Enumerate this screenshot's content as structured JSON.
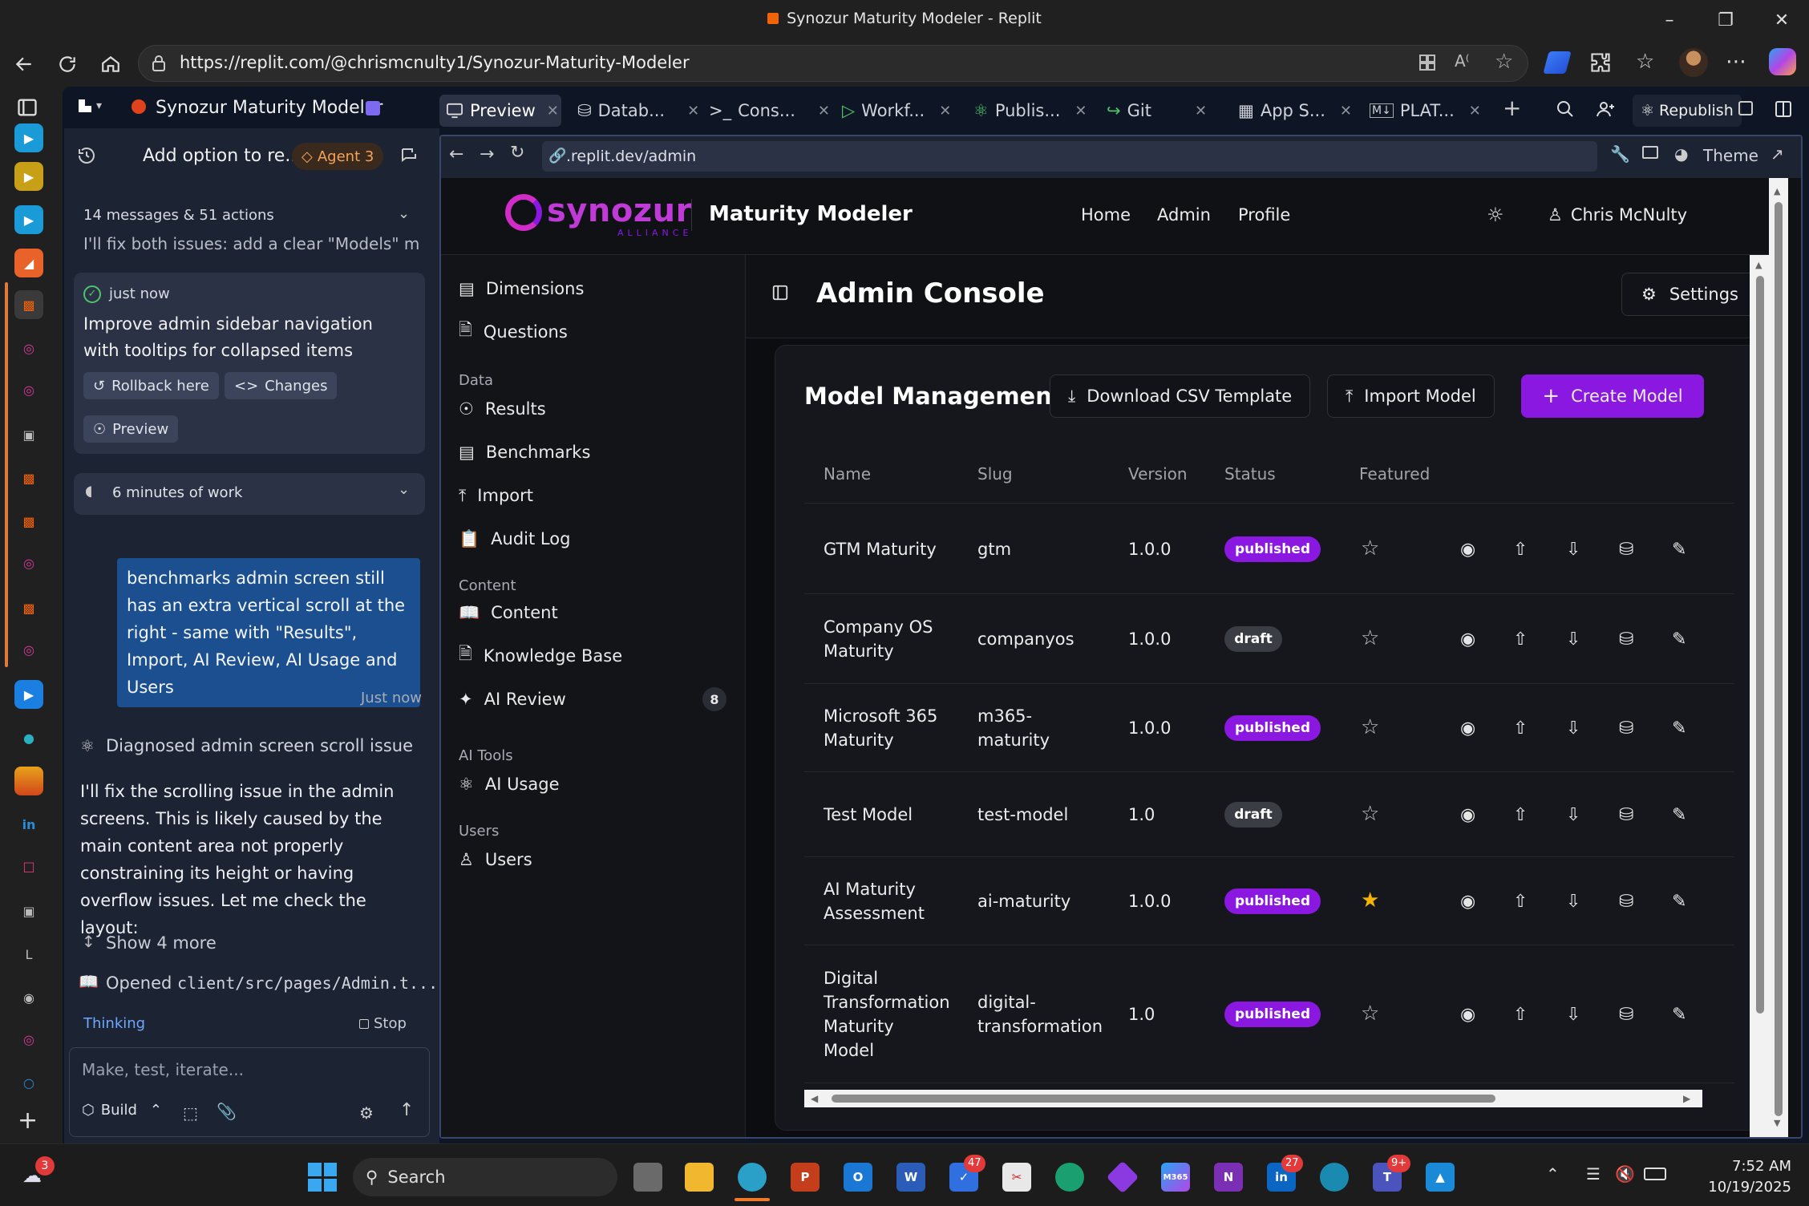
{
  "browser": {
    "window_title": "Synozur Maturity Modeler - Replit",
    "url": "https://replit.com/@chrismcnulty1/Synozur-Maturity-Modeler"
  },
  "replit": {
    "project_name": "Synozur Maturity Modeler",
    "tabs": [
      {
        "label": "Preview",
        "icon": "monitor-icon"
      },
      {
        "label": "Datab...",
        "icon": "database-icon"
      },
      {
        "label": "Cons...",
        "icon": "terminal-icon"
      },
      {
        "label": "Workf...",
        "icon": "play-icon"
      },
      {
        "label": "Publis...",
        "icon": "publish-icon"
      },
      {
        "label": "Git",
        "icon": "git-icon"
      },
      {
        "label": "App S...",
        "icon": "app-storage-icon"
      },
      {
        "label": "PLAT...",
        "icon": "markdown-icon"
      }
    ],
    "republish_label": "Republish"
  },
  "agent": {
    "header_title": "Add option to re...",
    "agent_badge": "Agent 3",
    "summary_count": "14 messages & 51 actions",
    "summary_preview": "I'll fix both issues: add a clear \"Models\" m...",
    "checkpoint_time": "just now",
    "checkpoint_text": "Improve admin sidebar navigation with tooltips for collapsed items",
    "rollback_label": "Rollback here",
    "changes_label": "Changes",
    "preview_label": "Preview",
    "work_time": "6 minutes of work",
    "user_message": "benchmarks admin screen still has an extra vertical scroll at the right - same with \"Results\", Import, AI Review, AI Usage and Users",
    "user_message_time": "Just now",
    "diagnosed": "Diagnosed admin screen scroll issue",
    "agent_reply": "I'll fix the scrolling issue in the admin screens. This is likely caused by the main content area not properly constraining its height or having overflow issues. Let me check the layout:",
    "show_more": "Show 4 more",
    "opened_prefix": "Opened",
    "opened_file": "client/src/pages/Admin.t...",
    "thinking": "Thinking",
    "stop": "Stop",
    "input_placeholder": "Make, test, iterate...",
    "build_label": "Build"
  },
  "preview": {
    "url": ".replit.dev/admin",
    "theme_label": "Theme"
  },
  "app": {
    "brand_name": "synozur",
    "brand_sub": "ALLIANCE",
    "app_title": "Maturity Modeler",
    "nav": [
      "Home",
      "Admin",
      "Profile"
    ],
    "user_name": "Chris McNulty",
    "page_title": "Admin Console",
    "settings_label": "Settings",
    "sidebar": {
      "top_items": [
        {
          "label": "Dimensions",
          "icon": "bar-chart-icon"
        },
        {
          "label": "Questions",
          "icon": "file-text-icon"
        }
      ],
      "sections": [
        {
          "heading": "Data",
          "items": [
            {
              "label": "Results",
              "icon": "eye-icon"
            },
            {
              "label": "Benchmarks",
              "icon": "bar-chart-icon"
            },
            {
              "label": "Import",
              "icon": "upload-icon"
            },
            {
              "label": "Audit Log",
              "icon": "clipboard-icon"
            }
          ]
        },
        {
          "heading": "Content",
          "items": [
            {
              "label": "Content",
              "icon": "book-icon"
            },
            {
              "label": "Knowledge Base",
              "icon": "file-text-icon"
            },
            {
              "label": "AI Review",
              "icon": "sparkles-icon",
              "badge": "8"
            }
          ]
        },
        {
          "heading": "AI Tools",
          "items": [
            {
              "label": "AI Usage",
              "icon": "brain-icon"
            }
          ]
        },
        {
          "heading": "Users",
          "items": [
            {
              "label": "Users",
              "icon": "users-icon"
            }
          ]
        }
      ]
    },
    "models": {
      "title": "Model Management",
      "download_label": "Download CSV Template",
      "import_label": "Import Model",
      "create_label": "Create Model",
      "columns": [
        "Name",
        "Slug",
        "Version",
        "Status",
        "Featured"
      ],
      "rows": [
        {
          "name": "GTM Maturity",
          "slug": "gtm",
          "version": "1.0.0",
          "status": "published",
          "featured": false
        },
        {
          "name": "Company OS Maturity",
          "slug": "companyos",
          "version": "1.0.0",
          "status": "draft",
          "featured": false
        },
        {
          "name": "Microsoft 365 Maturity",
          "slug": "m365-maturity",
          "version": "1.0.0",
          "status": "published",
          "featured": false
        },
        {
          "name": "Test Model",
          "slug": "test-model",
          "version": "1.0",
          "status": "draft",
          "featured": false
        },
        {
          "name": "AI Maturity Assessment",
          "slug": "ai-maturity",
          "version": "1.0.0",
          "status": "published",
          "featured": true
        },
        {
          "name": "Digital Transformation Maturity Model",
          "slug": "digital-transformation",
          "version": "1.0",
          "status": "published",
          "featured": false
        }
      ]
    }
  },
  "taskbar": {
    "search_label": "Search",
    "time": "7:52 AM",
    "date": "10/19/2025",
    "badges": {
      "weather": "3",
      "todo": "47",
      "linkedin": "27",
      "teams": "9+"
    }
  },
  "colors": {
    "accent_purple": "#8b18e0",
    "replit_bg": "#0e1525",
    "agent_bg": "#1c2333",
    "user_bubble": "#1b4f8f"
  }
}
